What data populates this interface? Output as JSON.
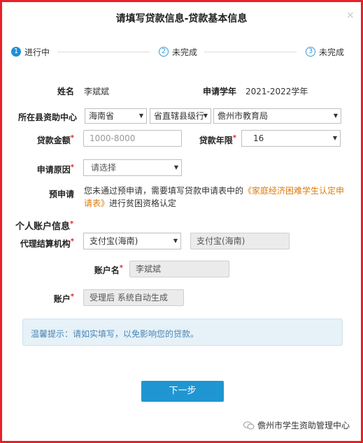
{
  "dialog": {
    "title": "请填写贷款信息-贷款基本信息",
    "close_glyph": "×"
  },
  "steps": [
    {
      "num": "1",
      "label": "进行中",
      "active": true
    },
    {
      "num": "2",
      "label": "未完成",
      "active": false
    },
    {
      "num": "3",
      "label": "未完成",
      "active": false
    }
  ],
  "form": {
    "name_label": "姓名",
    "name_value": "李斌斌",
    "year_label": "申请学年",
    "year_value": "2021-2022学年",
    "center_label": "所在县资助中心",
    "province": "海南省",
    "county": "省直辖县级行",
    "bureau": "儋州市教育局",
    "amount_label": "贷款金额",
    "amount_placeholder": "1000-8000",
    "term_label": "贷款年限",
    "term_value": "16",
    "reason_label": "申请原因",
    "reason_value": "请选择",
    "pre_label": "预申请",
    "pre_text_1": "您未通过预申请，需要填写贷款申请表中的",
    "pre_link": "《家庭经济困难学生认定申请表》",
    "pre_text_2": "进行贫困资格认定",
    "account_section": "个人账户信息",
    "agency_label": "代理结算机构",
    "agency_select": "支付宝(海南)",
    "agency_readonly": "支付宝(海南)",
    "account_name_label": "账户名",
    "account_name_value": "李斌斌",
    "account_label": "账户",
    "account_value": "受理后 系统自动生成",
    "required_mark": "*"
  },
  "tip": {
    "text": "温馨提示：请如实填写，以免影响您的贷款。"
  },
  "next_button": "下一步",
  "watermark": "儋州市学生资助管理中心",
  "colors": {
    "frame": "#e8202a",
    "primary": "#1f96d2",
    "link": "#e07a0a",
    "tip_bg": "#e6f1f8"
  }
}
